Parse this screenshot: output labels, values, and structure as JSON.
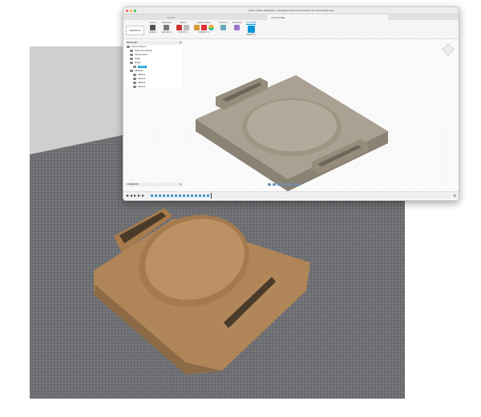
{
  "window": {
    "title": "Carrot Coffee (Wall Base) - Autodesk Fusion Personal (Not for Commercial Use)",
    "tabs": [
      {
        "label": "Untitled"
      },
      {
        "label": "Carrot Coffee"
      }
    ]
  },
  "ribbon": {
    "workspace": "DESIGN ▾",
    "tabs": [
      "SOLID",
      "SURFACE",
      "MESH",
      "SHEET METAL",
      "PLASTIC",
      "MANAGE",
      "UTILITIES"
    ],
    "selected_tab": "UTILITIES",
    "groups": [
      "MAKE ▾",
      "ADD-INS ▾",
      "UTILITY ▾",
      "INSPECT ▾",
      "SELECT ▾"
    ]
  },
  "browser": {
    "header": "BROWSER",
    "items": [
      {
        "label": "Carrot Coffee v1"
      },
      {
        "label": "Document Settings"
      },
      {
        "label": "Named Views"
      },
      {
        "label": "Origin"
      },
      {
        "label": "Bodies"
      },
      {
        "label": "Body1"
      },
      {
        "label": "Sketches"
      },
      {
        "label": "Sketch1"
      },
      {
        "label": "Sketch2"
      },
      {
        "label": "Sketch3"
      },
      {
        "label": "Sketch4"
      }
    ]
  },
  "comments": "COMMENTS",
  "colors": {
    "accent": "#0696d7",
    "model": "#a89f90",
    "wood": "#b58a5e"
  }
}
